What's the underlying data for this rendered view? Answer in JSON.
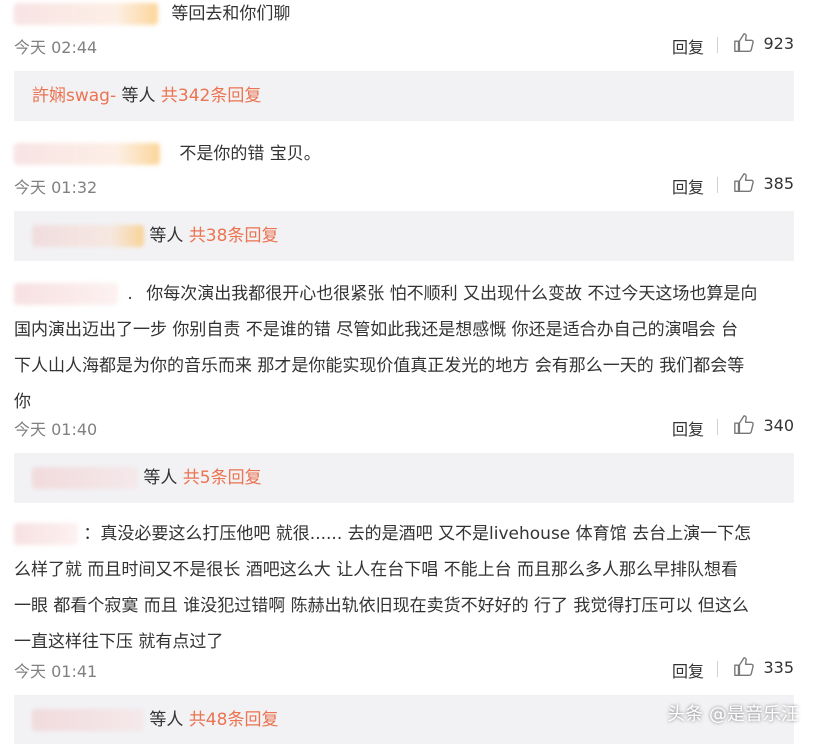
{
  "comments": [
    {
      "text_lines": [
        "等回去和你们聊"
      ],
      "time": "今天 02:44",
      "reply_label": "回复",
      "likes": "923",
      "sub": {
        "name": "許娴swag-",
        "and_label": "等人",
        "count_label": "共342条回复"
      }
    },
    {
      "text_lines": [
        "不是你的错 宝贝。"
      ],
      "time": "今天 01:32",
      "reply_label": "回复",
      "likes": "385",
      "sub": {
        "name": "",
        "and_label": "等人",
        "count_label": "共38条回复"
      }
    },
    {
      "text_lines": [
        "你每次演出我都很开心也很紧张 怕不顺利 又出现什么变故 不过今天这场也算是向",
        "国内演出迈出了一步 你别自责 不是谁的错 尽管如此我还是想感慨 你还是适合办自己的演唱会 台",
        "下人山人海都是为你的音乐而来 那才是你能实现价值真正发光的地方 会有那么一天的 我们都会等",
        "你"
      ],
      "time": "今天 01:40",
      "reply_label": "回复",
      "likes": "340",
      "sub": {
        "name": "",
        "and_label": "等人",
        "count_label": "共5条回复"
      }
    },
    {
      "text_lines": [
        "：真没必要这么打压他吧 就很...... 去的是酒吧 又不是livehouse 体育馆  去台上演一下怎",
        "么样了就 而且时间又不是很长 酒吧这么大 让人在台下唱 不能上台 而且那么多人那么早排队想看",
        "一眼 都看个寂寞 而且 谁没犯过错啊 陈赫出轨依旧现在卖货不好好的 行了 我觉得打压可以 但这么",
        "一直这样往下压 就有点过了"
      ],
      "time": "今天 01:41",
      "reply_label": "回复",
      "likes": "335",
      "sub": {
        "name": "",
        "and_label": "等人",
        "count_label": "共48条回复"
      }
    }
  ],
  "watermark": "头条 @是音乐汪",
  "colors": {
    "accent": "#eb7350",
    "subbox_bg": "#f2f2f5",
    "meta_text": "#808080"
  },
  "icons": {
    "like": "thumbs-up-icon"
  }
}
